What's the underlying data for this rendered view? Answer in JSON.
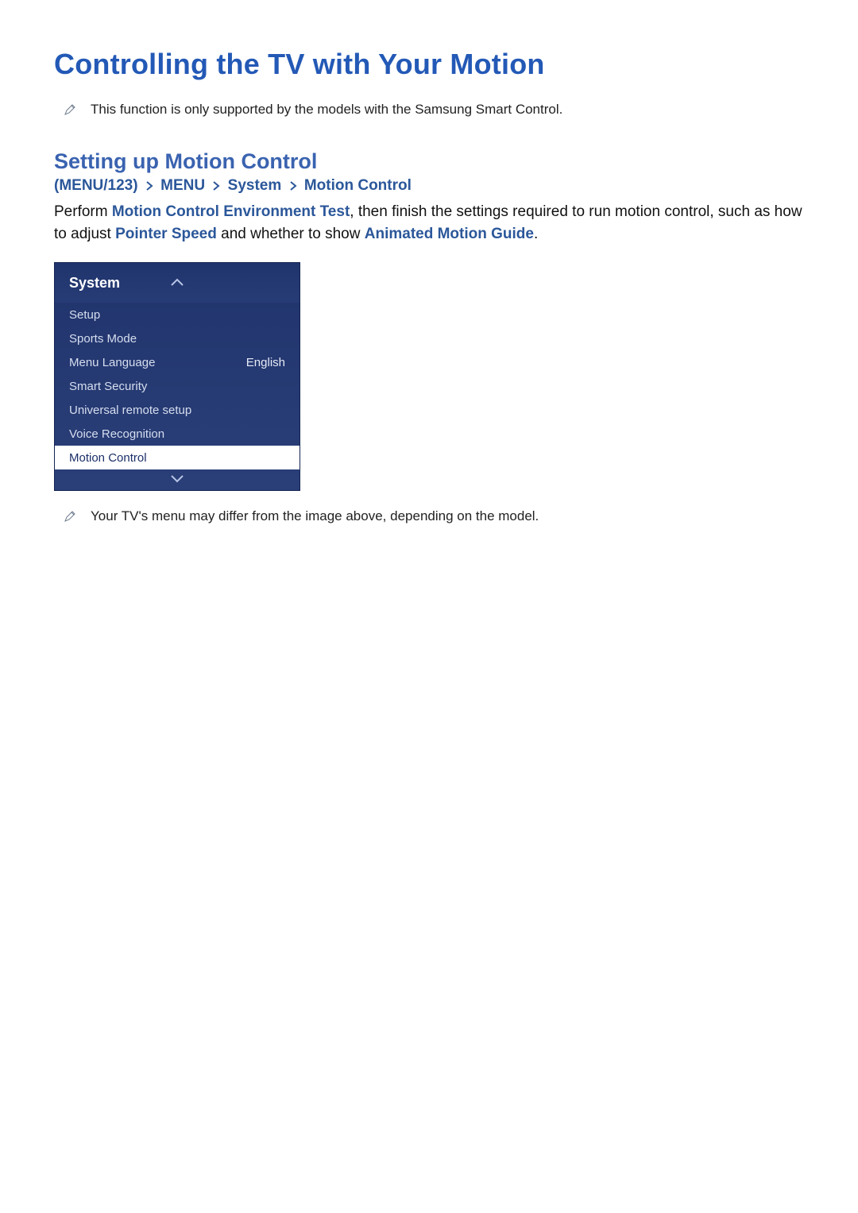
{
  "page": {
    "title": "Controlling the TV with Your Motion"
  },
  "notes": {
    "top": "This function is only supported by the models with the Samsung Smart Control.",
    "bottom": "Your TV's menu may differ from the image above, depending on the model."
  },
  "section": {
    "title": "Setting up Motion Control"
  },
  "breadcrumb": {
    "open": "(",
    "menu123": "MENU/123",
    "close_paren": ")",
    "menu": "MENU",
    "system": "System",
    "motion": "Motion Control"
  },
  "body": {
    "p1_a": "Perform ",
    "p1_hi1": "Motion Control Environment Test",
    "p1_b": ", then finish the settings required to run motion control, such as how to adjust ",
    "p1_hi2": "Pointer Speed",
    "p1_c": " and whether to show ",
    "p1_hi3": "Animated Motion Guide",
    "p1_d": "."
  },
  "tvmenu": {
    "title": "System",
    "rows": [
      {
        "label": "Setup",
        "value": "",
        "selected": false
      },
      {
        "label": "Sports Mode",
        "value": "",
        "selected": false
      },
      {
        "label": "Menu Language",
        "value": "English",
        "selected": false
      },
      {
        "label": "Smart Security",
        "value": "",
        "selected": false
      },
      {
        "label": "Universal remote setup",
        "value": "",
        "selected": false
      },
      {
        "label": "Voice Recognition",
        "value": "",
        "selected": false
      },
      {
        "label": "Motion Control",
        "value": "",
        "selected": true
      }
    ]
  }
}
